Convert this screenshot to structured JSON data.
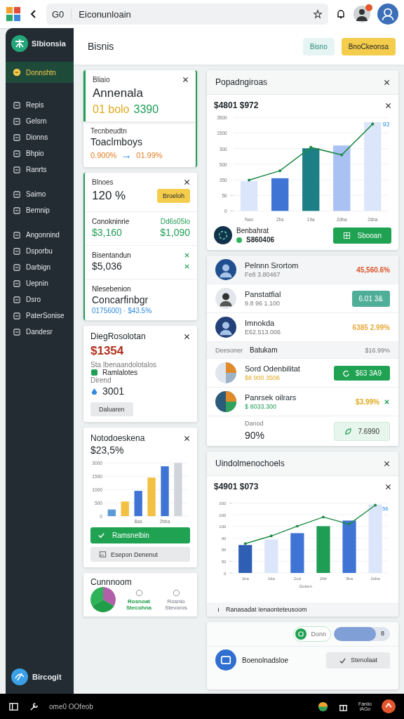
{
  "browser": {
    "tab_label": "G0",
    "address": "Eiconunloain"
  },
  "brand": {
    "name": "Slbionsia"
  },
  "header": {
    "title": "Bisnis",
    "buttons": [
      {
        "label": "Bisno",
        "kind": "outline"
      },
      {
        "label": "BnoCkeonsa",
        "kind": "primary"
      }
    ]
  },
  "sidebar": {
    "sections": [
      {
        "items": [
          {
            "label": "Donnshtn",
            "selected": true
          }
        ]
      },
      {
        "items": [
          {
            "label": "Repis",
            "selected": false
          },
          {
            "label": "Gelsrn",
            "selected": false
          },
          {
            "label": "Dionns",
            "selected": false
          },
          {
            "label": "Bhpio",
            "selected": false
          },
          {
            "label": "Ranrts",
            "selected": false
          }
        ]
      },
      {
        "items": [
          {
            "label": "Saimo",
            "selected": false
          },
          {
            "label": "Bemnip",
            "selected": false
          }
        ]
      },
      {
        "items": [
          {
            "label": "Angonnind",
            "selected": false
          },
          {
            "label": "Dsporbu",
            "selected": false
          },
          {
            "label": "Darbign",
            "selected": false
          },
          {
            "label": "Uepnin",
            "selected": false
          },
          {
            "label": "Dsro",
            "selected": false
          },
          {
            "label": "PaterSonise",
            "selected": false
          },
          {
            "label": "Dandesr",
            "selected": false
          }
        ]
      }
    ],
    "footer": "Bircogit"
  },
  "summary_card": {
    "label": "Bliaio",
    "title": "Annenala",
    "value_a": "01 bolo",
    "value_b": "3390",
    "sub_label": "Tecnbeudtn",
    "sub_title": "Toaclmboys",
    "change_a": "0.900%",
    "arrow": "→",
    "change_b": "01.99%"
  },
  "balance_card": {
    "label": "Blnoes",
    "value": "120 %",
    "badge": "Broeloh",
    "rows": [
      {
        "label": "Conokninrie",
        "note": "Dd6s05lo",
        "value": "$3,160",
        "value_b": "$1,090"
      },
      {
        "label": "Bisentandun",
        "value": "$5,036"
      }
    ],
    "extra_label": "Nlesebenion",
    "extra_title": "Concarfinbgr",
    "extra_value": "0175600) · $43.5%"
  },
  "dialog_card": {
    "title": "DiegRosolotan",
    "value": "$1354",
    "caption": "Sta  Ibenaandolotalos",
    "item": "Ramlalotes",
    "sub_label": "Dirend",
    "sub_value": "3001",
    "button": "Daluaren"
  },
  "mini_chart_card": {
    "title": "Notodoeskena",
    "value": "$23,5%",
    "y_labels": [
      "3000",
      "1590",
      "1000",
      "500",
      "0"
    ],
    "x_labels": [
      "Bas",
      "2bba"
    ],
    "primary_button": "Ramsnelbin",
    "secondary_button": "Esepon Denenut"
  },
  "pie_card": {
    "title": "Cunnnoom",
    "items": [
      {
        "label": "Rosnoat Stecohna",
        "selected": true
      },
      {
        "label": "Rosnio Stevoros",
        "selected": false
      }
    ]
  },
  "chart_cards": [
    {
      "title": "Popadngiroas",
      "y_labels": [
        "3500",
        "1500",
        "300",
        "500",
        "350",
        "50",
        "0"
      ],
      "chart_data": {
        "type": "bar",
        "title": "$4801 $972",
        "ylim": [
          0,
          300
        ],
        "yticks": [
          0,
          50
        ],
        "categories": [
          "Nan",
          "2bs",
          "19a",
          "2dba",
          "2sba"
        ],
        "series": [
          {
            "colors": [
              "#dbe6fb",
              "#3f74d4",
              "#1d7f86",
              "#a9c1f3",
              "#dbe6fb"
            ],
            "values": [
              96,
              105,
              201,
              210,
              285
            ]
          },
          {
            "type": "line",
            "color": "#1f8a45",
            "values": [
              99,
              129,
              204,
              180,
              279
            ]
          }
        ]
      },
      "end_label": "93",
      "footer_name": "Benbahrat",
      "footer_value": "S860406",
      "button": "Sbooan"
    },
    {
      "title": "Uindolmenochoels",
      "y_labels": [
        "300",
        "200",
        "100",
        "00",
        "00",
        "50",
        "0"
      ],
      "chart_data": {
        "type": "bar",
        "title": "$4901 $073",
        "xlabel": "Doben",
        "ylim": [
          0,
          300
        ],
        "yticks": [
          0,
          50,
          300
        ],
        "categories": [
          "1ba",
          "1da",
          "2od",
          "2bb",
          "3ba",
          "2sba"
        ],
        "series": [
          {
            "colors": [
              "#2f5fb5",
              "#dbe6fb",
              "#3f74d4",
              "#1f9d55",
              "#3f74d4",
              "#dbe6fb"
            ],
            "values": [
              120,
              144,
              171,
              201,
              225,
              294
            ]
          },
          {
            "type": "line",
            "color": "#1f8a45",
            "values": [
              126,
              159,
              201,
              240,
              210,
              291
            ]
          }
        ]
      },
      "end_label": "56",
      "footer_note": "Ranasadat Ienaonteteusoom"
    }
  ],
  "list_card": {
    "rows": [
      {
        "name": "Pelnnn Srortom",
        "sub": "Fe8 3.80467",
        "amount": "45,560.6%",
        "kind": "text",
        "color": "#d9542b"
      },
      {
        "name": "Panstatfial",
        "sub": "9.8 96 1.100",
        "amount": "6.01 3&",
        "kind": "badge",
        "color": "#4fae98"
      },
      {
        "name": "Imnokda",
        "sub": "E62.513.006",
        "amount": "6385 2.99%",
        "kind": "text",
        "color": "#e8a93a"
      }
    ],
    "section": {
      "label": "Deesoner",
      "title": "Batukam",
      "value": "$16.99%"
    },
    "rows_b": [
      {
        "name": "Sord Odenbilitat",
        "sub": "$8 900 3506",
        "amount": "$63 3A9",
        "kind": "button"
      },
      {
        "name": "Panrsek oilrars",
        "sub": "$ 8033.300",
        "amount": "$3.99%",
        "kind": "text"
      }
    ],
    "total": {
      "label": "Danod",
      "value": "90%",
      "button": "7.6990"
    }
  },
  "controls": {
    "toggle_label": "Donn",
    "slider_value": "8",
    "level": 0.75,
    "label": "Boenolnadsloe",
    "button": "Stenolaat"
  },
  "taskbar": {
    "search": "ome0 OOfeob",
    "clock_top": "Faniio",
    "clock_bottom": "iAGo"
  }
}
